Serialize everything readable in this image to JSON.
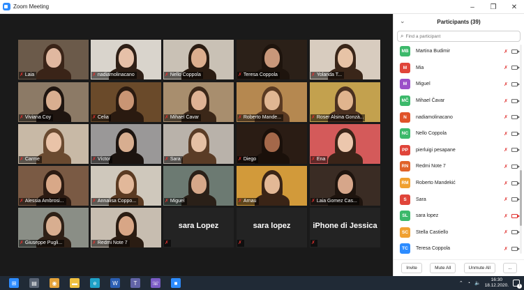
{
  "window": {
    "title": "Zoom Meeting",
    "minimize": "–",
    "restore": "❐",
    "close": "✕"
  },
  "gallery": [
    {
      "name": "Laia",
      "bg": "#6b5a4a",
      "skin": "#e0b8a0",
      "hair": "#3a2418"
    },
    {
      "name": "nadiamolinacano",
      "bg": "#d9d4cc",
      "skin": "#e6c0a8",
      "hair": "#2e1f16"
    },
    {
      "name": "Nello Coppola",
      "bg": "#c9c1b5",
      "skin": "#dcae8e",
      "hair": "#2a1c12"
    },
    {
      "name": "Teresa Coppola",
      "bg": "#2b2018",
      "skin": "#c8977a",
      "hair": "#1e140d"
    },
    {
      "name": "Yolanda T...",
      "bg": "#d8ccbf",
      "skin": "#e7c3a6",
      "hair": "#3a2619"
    },
    {
      "name": "Viviana Coy",
      "bg": "#8c7a66",
      "skin": "#d8ae90",
      "hair": "#1f1510"
    },
    {
      "name": "Celia",
      "bg": "#6a4a2a",
      "skin": "#c99574",
      "hair": "#2a1a10"
    },
    {
      "name": "Mihael Čavar",
      "bg": "#a88e6e",
      "skin": "#deb294",
      "hair": "#3b2718"
    },
    {
      "name": "Roberto Mande...",
      "bg": "#b58850",
      "skin": "#e0b692",
      "hair": "#5a3a22"
    },
    {
      "name": "Roser Alsina Gonzà...",
      "bg": "#c3a14e",
      "skin": "#e0b48e",
      "hair": "#4a3020"
    },
    {
      "name": "Carme",
      "bg": "#c8b9a6",
      "skin": "#e9c3a8",
      "hair": "#6a4a30"
    },
    {
      "name": "Víctor",
      "bg": "#9a9898",
      "skin": "#d8ae90",
      "hair": "#1c1410"
    },
    {
      "name": "Sara",
      "bg": "#b9b2aa",
      "skin": "#e5c0a4",
      "hair": "#5a3c26"
    },
    {
      "name": "Diego",
      "bg": "#2a1c14",
      "skin": "#a4684a",
      "hair": "#1a100a"
    },
    {
      "name": "Ena",
      "bg": "#d45a5a",
      "skin": "#ecc7ad",
      "hair": "#3a2418"
    },
    {
      "name": "Alessia Ambrosi...",
      "bg": "#7a5a44",
      "skin": "#d8a888",
      "hair": "#2c1b12"
    },
    {
      "name": "Annalisa Coppo...",
      "bg": "#cfc8bc",
      "skin": "#e2b89a",
      "hair": "#5a3a22"
    },
    {
      "name": "Miguel",
      "bg": "#6c7a72",
      "skin": "#d6a88a",
      "hair": "#2a2018"
    },
    {
      "name": "Arnau",
      "bg": "#d29a3a",
      "skin": "#e3b896",
      "hair": "#3a2416"
    },
    {
      "name": "Laia Gomez Cas...",
      "bg": "#3a2c24",
      "skin": "#d6a68a",
      "hair": "#1e140e"
    },
    {
      "name": "Giuseppe Pugli...",
      "bg": "#8a8e86",
      "skin": "#d8ae90",
      "hair": "#2e2016"
    },
    {
      "name": "Redmi Note 7",
      "bg": "#c7bdb0",
      "skin": "#d8a686",
      "hair": "#2a1c12"
    },
    {
      "name": "sara Lopez",
      "bg": "",
      "text_only": true
    },
    {
      "name": "sara lopez",
      "bg": "",
      "text_only": true
    },
    {
      "name": "iPhone di Jessica",
      "bg": "",
      "text_only": true
    }
  ],
  "panel": {
    "title": "Participants (39)",
    "collapse_icon": "⌄",
    "search_placeholder": "Find a participant",
    "participants": [
      {
        "initials": "MB",
        "name": "Martina Budimir",
        "color": "#3cb96b",
        "cam_off": false
      },
      {
        "initials": "M",
        "name": "Mia",
        "color": "#e0453a",
        "cam_off": false
      },
      {
        "initials": "M",
        "name": "Miguel",
        "color": "#9b4fc8",
        "cam_off": false
      },
      {
        "initials": "MČ",
        "name": "Mihael Čavar",
        "color": "#3cb96b",
        "cam_off": false
      },
      {
        "initials": "N",
        "name": "nadiamolinacano",
        "color": "#e0532a",
        "cam_off": false
      },
      {
        "initials": "NC",
        "name": "Nello Coppola",
        "color": "#3cb96b",
        "cam_off": false
      },
      {
        "initials": "PP",
        "name": "pierluigi pesapane",
        "color": "#e0453a",
        "cam_off": false
      },
      {
        "initials": "RN",
        "name": "Redmi Note 7",
        "color": "#e0632a",
        "cam_off": false
      },
      {
        "initials": "RM",
        "name": "Roberto Mandekić",
        "color": "#f0a030",
        "cam_off": false
      },
      {
        "initials": "S",
        "name": "Sara",
        "color": "#e0453a",
        "cam_off": false
      },
      {
        "initials": "SL",
        "name": "sara lopez",
        "color": "#3cb96b",
        "cam_off": true
      },
      {
        "initials": "SC",
        "name": "Stella Castiello",
        "color": "#f0a030",
        "cam_off": false
      },
      {
        "initials": "TC",
        "name": "Teresa Coppola",
        "color": "#2d8cff",
        "cam_off": false
      }
    ],
    "footer": {
      "invite": "Invite",
      "mute_all": "Mute All",
      "unmute_all": "Unmute All",
      "more": "..."
    }
  },
  "taskbar": {
    "apps": [
      "windows-start",
      "task-view",
      "chrome",
      "file-explorer",
      "edge",
      "word",
      "teams",
      "viber",
      "zoom"
    ],
    "time": "16:30",
    "date": "18.12.2020.",
    "notifications": "7"
  }
}
